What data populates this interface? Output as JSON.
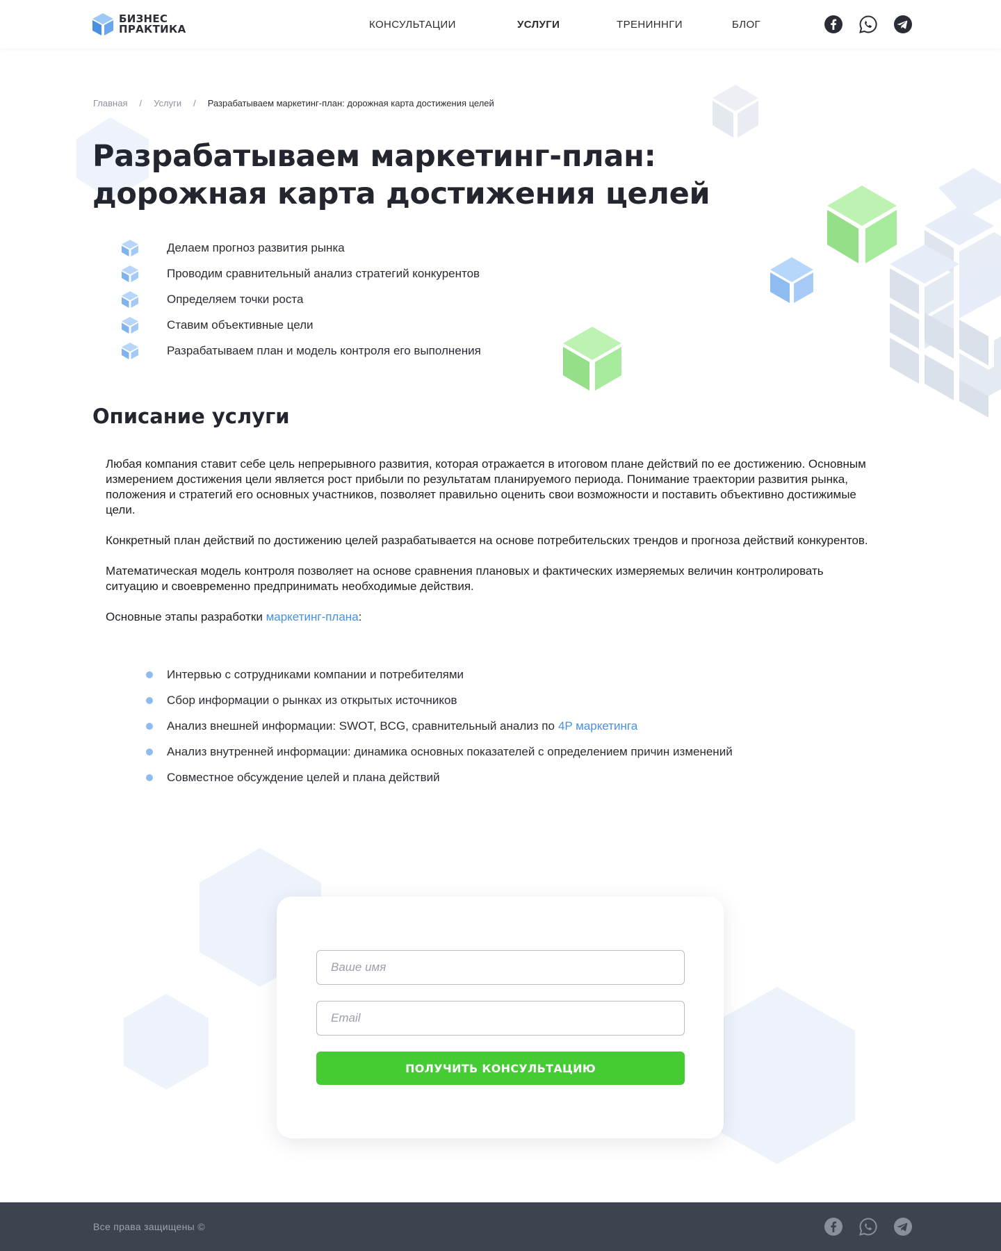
{
  "header": {
    "logo_line1": "БИЗНЕС",
    "logo_line2": "ПРАКТИКА",
    "nav": [
      {
        "label": "КОНСУЛЬТАЦИИ",
        "active": false
      },
      {
        "label": "УСЛУГИ",
        "active": true
      },
      {
        "label": "ТРЕНИННГИ",
        "active": false
      },
      {
        "label": "БЛОГ",
        "active": false
      }
    ],
    "socials": [
      "facebook-icon",
      "whatsapp-icon",
      "telegram-icon"
    ]
  },
  "breadcrumbs": {
    "items": [
      "Главная",
      "Услуги",
      "Разрабатываем маркетинг-план: дорожная карта достижения целей"
    ],
    "separator": "/"
  },
  "page": {
    "title": "Разрабатываем маркетинг-план: дорожная карта достижения целей",
    "features": [
      "Делаем прогноз развития рынка",
      "Проводим сравнительный анализ стратегий конкурентов",
      "Определяем точки роста",
      "Ставим объективные цели",
      "Разрабатываем план и модель контроля его выполнения"
    ]
  },
  "description": {
    "heading": "Описание услуги",
    "paragraphs": [
      "Любая компания ставит себе цель непрерывного развития, которая отражается в итоговом плане действий по ее достижению. Основным измерением достижения цели является рост прибыли по результатам планируемого периода. Понимание траектории развития рынка, положения и стратегий его основных участников, позволяет правильно оценить свои возможности и поставить объективно достижимые цели.",
      "Конкретный план действий по достижению целей разрабатывается на основе потребительских трендов и прогноза действий конкурентов.",
      "Математическая модель контроля позволяет на основе сравнения плановых и фактических измеряемых величин контролировать ситуацию и своевременно предпринимать необходимые действия."
    ],
    "stages_intro": "Основные этапы разработки",
    "stages_link": "маркетинг-плана",
    "stages_colon": ":",
    "steps": [
      {
        "text": "Интервью с сотрудниками компании и потребителями"
      },
      {
        "text": "Сбор информации о рынках из открытых источников"
      },
      {
        "text": "Анализ внешней информации: SWOT, BCG, сравнительный анализ по",
        "link": "4P маркетинга"
      },
      {
        "text": "Анализ внутренней информации: динамика основных показателей с определением причин изменений"
      },
      {
        "text": "Совместное обсуждение целей и плана действий"
      }
    ]
  },
  "form": {
    "name_placeholder": "Ваше имя",
    "name_value": "",
    "email_placeholder": "Email",
    "email_value": "",
    "submit_label": "ПОЛУЧИТЬ КОНСУЛЬТАЦИЮ",
    "submit_color": "#45cc35"
  },
  "footer": {
    "copyright": "Все права защищены ©",
    "socials": [
      "facebook-icon",
      "whatsapp-icon",
      "telegram-icon"
    ]
  },
  "colors": {
    "text": "#23262e",
    "link": "#4a90e2",
    "accent_green": "#45cc35",
    "footer_bg": "#3e444f",
    "cube_blue": "#8fbcf0",
    "cube_green": "#a3e69a",
    "hex_bg": "#eaf1fb"
  }
}
